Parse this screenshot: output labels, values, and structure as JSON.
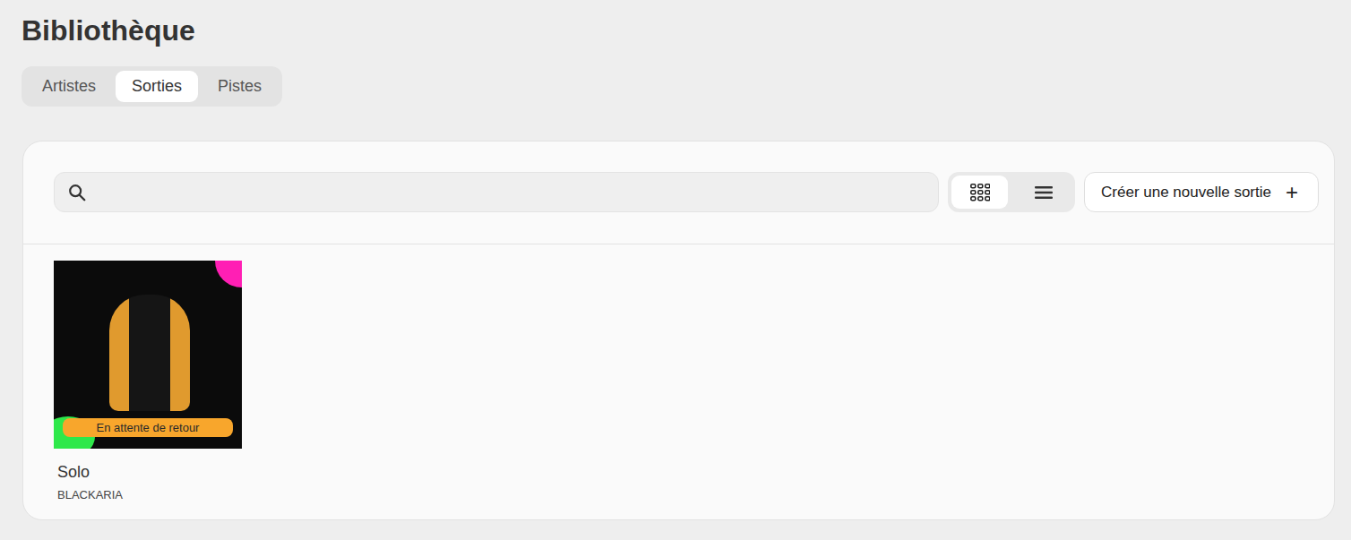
{
  "page": {
    "title": "Bibliothèque"
  },
  "tabs": [
    {
      "label": "Artistes",
      "selected": false
    },
    {
      "label": "Sorties",
      "selected": true
    },
    {
      "label": "Pistes",
      "selected": false
    }
  ],
  "search": {
    "placeholder": ""
  },
  "view_modes": [
    {
      "kind": "grid",
      "selected": true
    },
    {
      "kind": "list",
      "selected": false
    }
  ],
  "create_button": {
    "label": "Créer une nouvelle sortie",
    "icon": "+"
  },
  "releases": [
    {
      "title": "Solo",
      "artist": "BLACKARIA",
      "status": "En attente de retour"
    }
  ]
}
